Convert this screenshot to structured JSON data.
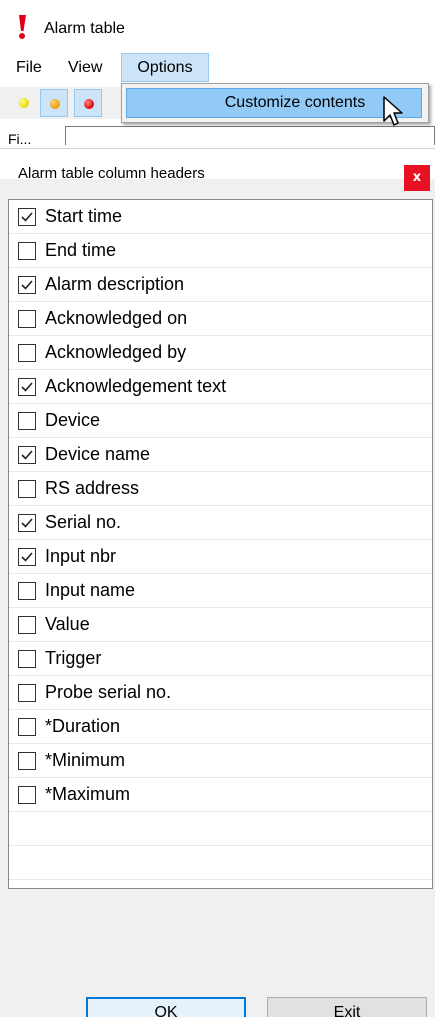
{
  "app": {
    "title": "Alarm table",
    "icon": "exclamation-icon",
    "accent_color": "#e0001b"
  },
  "menu": {
    "items": [
      "File",
      "View",
      "Options"
    ],
    "active": "Options",
    "dropdown_item": "Customize contents"
  },
  "toolbar": {
    "buttons": [
      {
        "icon": "yellow-dot-icon",
        "color": "#e9d400",
        "pressed": false
      },
      {
        "icon": "orange-dot-icon",
        "color": "#f09a00",
        "pressed": true
      },
      {
        "icon": "red-dot-icon",
        "color": "#e00000",
        "pressed": true
      }
    ]
  },
  "filter": {
    "label": "Fi..."
  },
  "dialog": {
    "title": "Alarm table column headers",
    "close_label": "x",
    "columns": [
      {
        "label": "Start time",
        "checked": true
      },
      {
        "label": "End time",
        "checked": false
      },
      {
        "label": "Alarm description",
        "checked": true
      },
      {
        "label": "Acknowledged on",
        "checked": false
      },
      {
        "label": "Acknowledged by",
        "checked": false
      },
      {
        "label": "Acknowledgement text",
        "checked": true
      },
      {
        "label": "Device",
        "checked": false
      },
      {
        "label": "Device name",
        "checked": true
      },
      {
        "label": "RS address",
        "checked": false
      },
      {
        "label": "Serial no.",
        "checked": true
      },
      {
        "label": "Input nbr",
        "checked": true
      },
      {
        "label": "Input name",
        "checked": false
      },
      {
        "label": "Value",
        "checked": false
      },
      {
        "label": "Trigger",
        "checked": false
      },
      {
        "label": "Probe serial no.",
        "checked": false
      },
      {
        "label": "*Duration",
        "checked": false
      },
      {
        "label": "*Minimum",
        "checked": false
      },
      {
        "label": "*Maximum",
        "checked": false
      }
    ],
    "ok_label": "OK",
    "exit_label": "Exit"
  }
}
